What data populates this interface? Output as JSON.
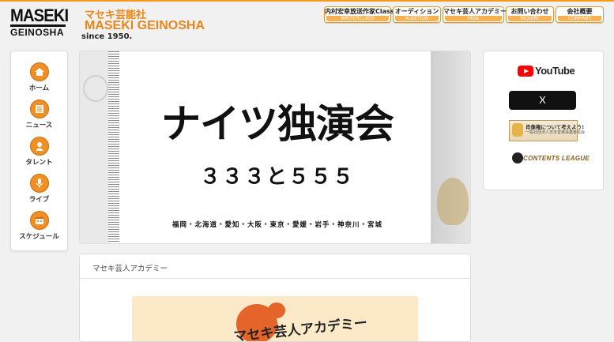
{
  "header": {
    "logo_top": "MASEKI",
    "logo_bottom": "GEINOSHA",
    "brand_jp": "マセキ芸能社",
    "brand_en": "MASEKI GEINOSHA",
    "since": "since 1950."
  },
  "topnav": [
    {
      "label": "内村宏幸放送作家Class",
      "sub": "WRITERCLASS"
    },
    {
      "label": "オーディション",
      "sub": "AUDITION"
    },
    {
      "label": "マセキ芸人アカデミー",
      "sub": "MGA"
    },
    {
      "label": "お問い合わせ",
      "sub": "INQUIRY"
    },
    {
      "label": "会社概要",
      "sub": "COMPANY"
    }
  ],
  "sidenav": [
    {
      "label": "ホーム",
      "icon": "home-icon"
    },
    {
      "label": "ニュース",
      "icon": "news-icon"
    },
    {
      "label": "タレント",
      "icon": "talent-icon"
    },
    {
      "label": "ライブ",
      "icon": "live-mic-icon"
    },
    {
      "label": "スケジュール",
      "icon": "calendar-icon"
    }
  ],
  "banner": {
    "title": "ナイツ独演会",
    "subtitle": "３３３と５５５",
    "places": "福岡・北海道・愛知・大阪・東京・愛媛・岩手・神奈川・宮城"
  },
  "social": {
    "youtube": "YouTube",
    "x": "X",
    "promo_line1": "肖像権について考えよう!",
    "promo_line2": "一般社団法人日本音楽事業者協会",
    "contents_league": "CONTENTS LEAGUE"
  },
  "academy": {
    "heading": "マセキ芸人アカデミー",
    "image_text": "マセキ芸人アカデミー"
  },
  "colors": {
    "accent": "#f08f23",
    "brand_text": "#e8861a",
    "youtube_red": "#ff0000"
  }
}
